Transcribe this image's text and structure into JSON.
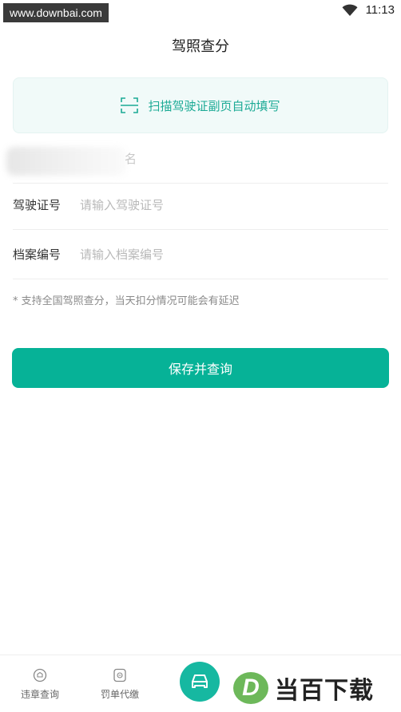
{
  "status_bar": {
    "watermark": "www.downbai.com",
    "time": "11:13",
    "wifi_icon": "wifi-icon"
  },
  "header": {
    "title": "驾照查分"
  },
  "scan": {
    "label": "扫描驾驶证副页自动填写",
    "icon": "scan-frame-icon",
    "color": "#1baa95"
  },
  "form": {
    "name_partial": "名",
    "license": {
      "label": "驾驶证号",
      "placeholder": "请输入驾驶证号",
      "value": ""
    },
    "archive": {
      "label": "档案编号",
      "placeholder": "请输入档案编号",
      "value": ""
    },
    "note": "* 支持全国驾照查分，当天扣分情况可能会有延迟"
  },
  "actions": {
    "submit_label": "保存并查询",
    "accent_color": "#06b297"
  },
  "bottom_nav": {
    "items": [
      {
        "label": "违章查询",
        "icon": "violation-search-icon"
      },
      {
        "label": "罚单代缴",
        "icon": "fine-payment-icon"
      }
    ],
    "center_icon": "car-icon"
  },
  "brand_watermark": {
    "logo_letter": "D",
    "text": "当百下载"
  }
}
